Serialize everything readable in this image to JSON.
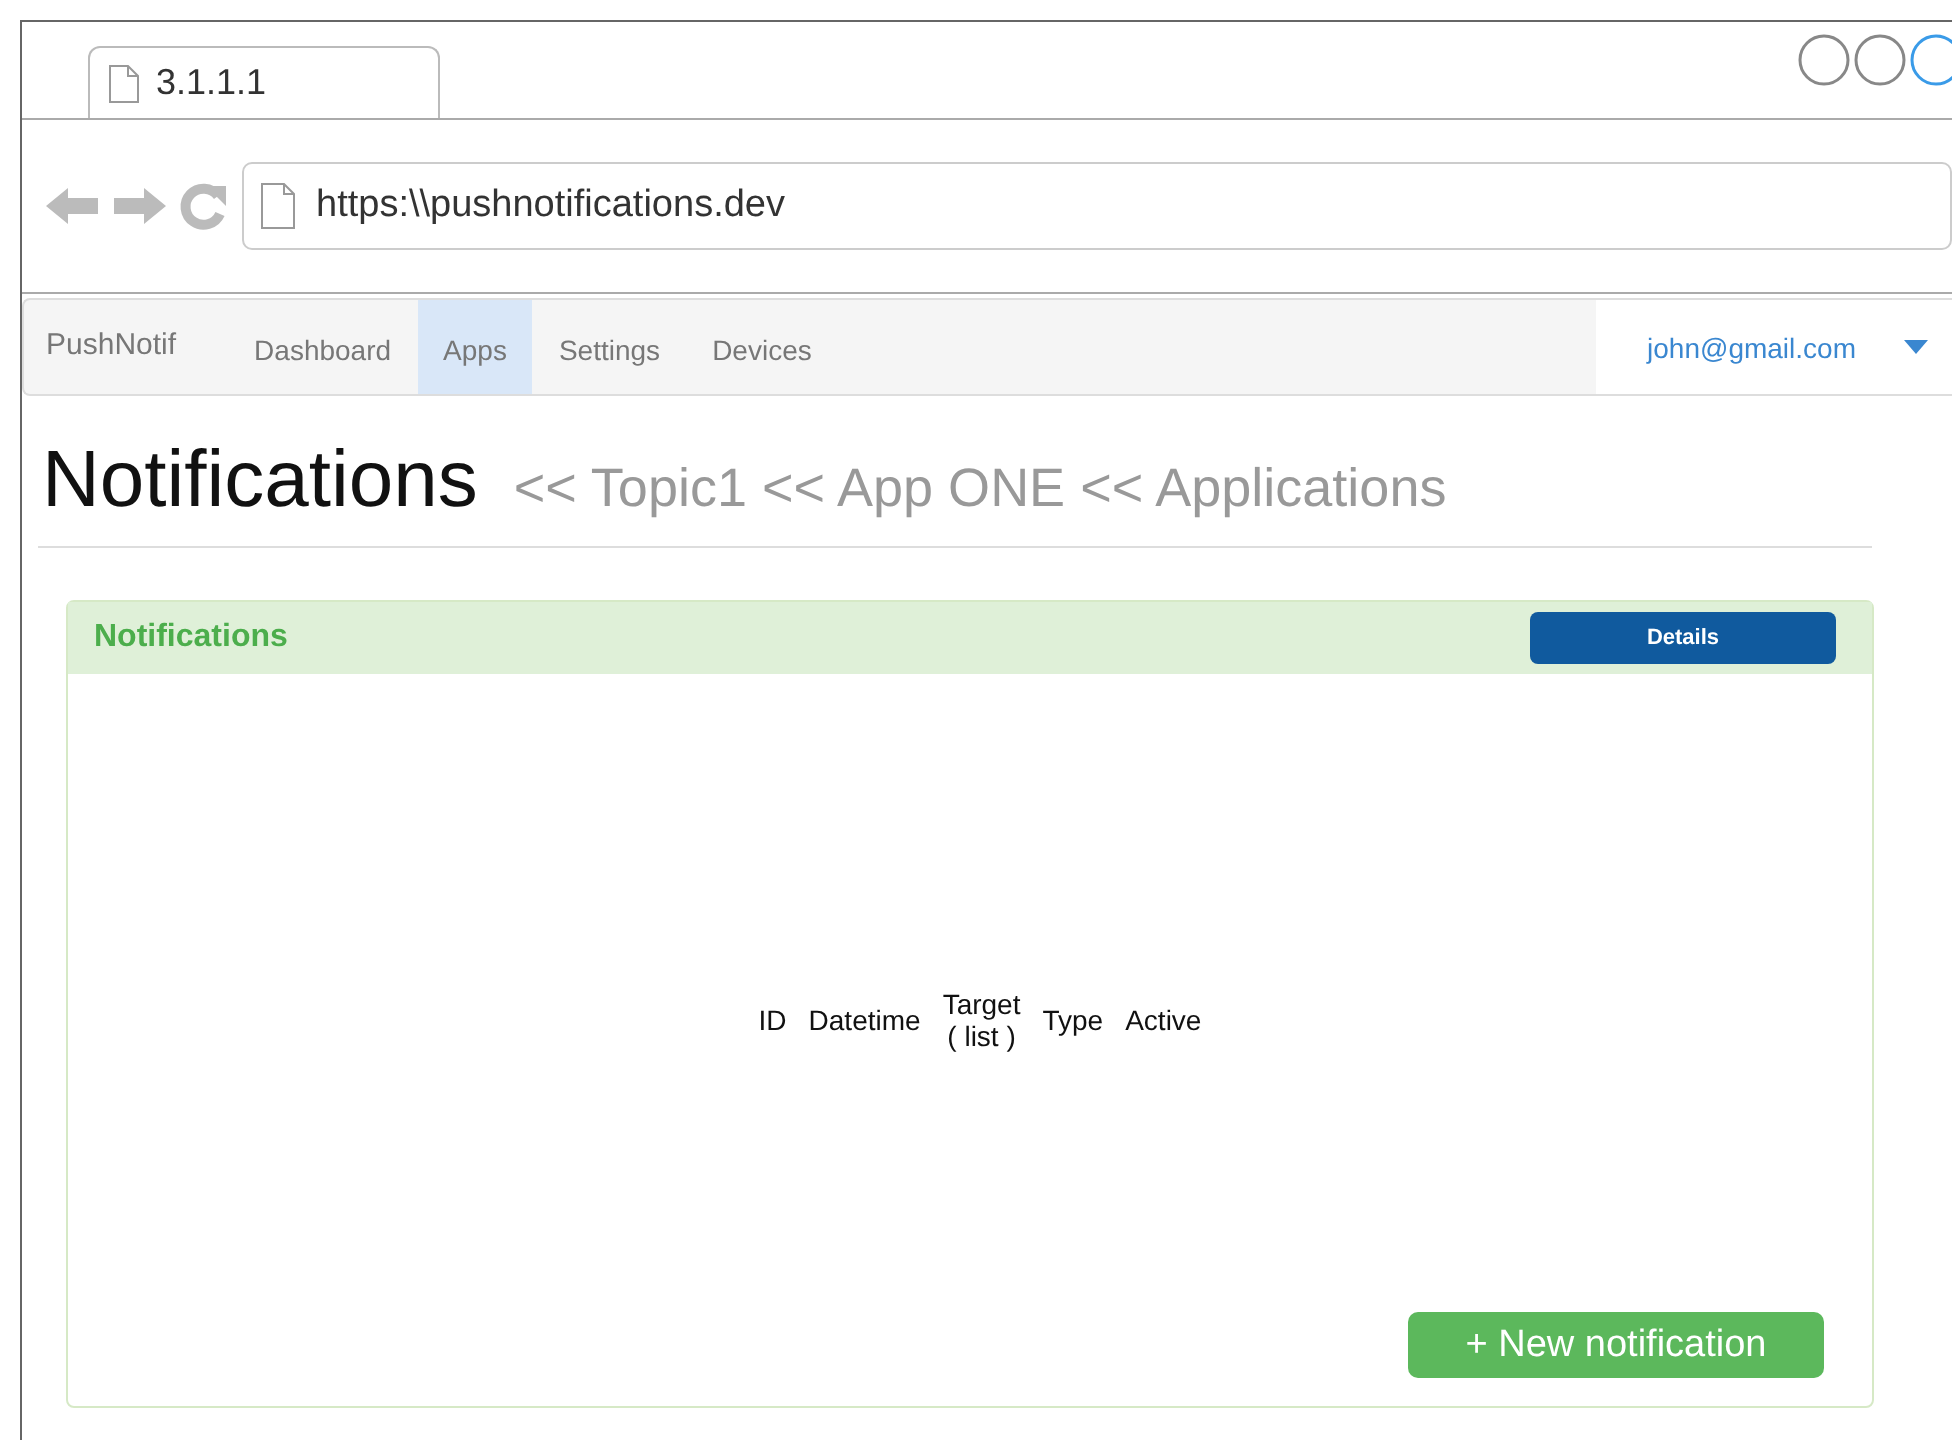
{
  "browser": {
    "tab_title": "3.1.1.1",
    "url": "https:\\\\pushnotifications.dev"
  },
  "navbar": {
    "brand": "PushNotif",
    "items": [
      {
        "label": "Dashboard",
        "selected": false
      },
      {
        "label": "Apps",
        "selected": true
      },
      {
        "label": "Settings",
        "selected": false
      },
      {
        "label": "Devices",
        "selected": false
      }
    ],
    "user": "john@gmail.com"
  },
  "page": {
    "title": "Notifications",
    "breadcrumb": "<< Topic1 << App ONE << Applications"
  },
  "panel": {
    "title": "Notifications",
    "details_button": "Details",
    "columns": [
      {
        "label": "ID"
      },
      {
        "label": "Datetime"
      },
      {
        "label": "Target",
        "note": "( list )"
      },
      {
        "label": "Type"
      },
      {
        "label": "Active"
      }
    ],
    "new_button": "+ New notification"
  }
}
